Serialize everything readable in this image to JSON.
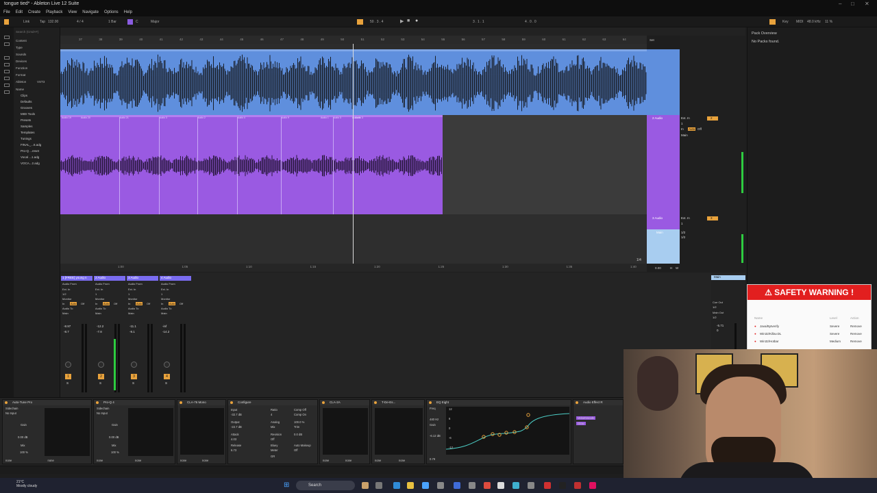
{
  "window": {
    "title": "tongue tied* - Ableton Live 12 Suite",
    "controls": [
      "–",
      "□",
      "✕"
    ]
  },
  "menu": [
    "File",
    "Edit",
    "Create",
    "Playback",
    "View",
    "Navigate",
    "Options",
    "Help"
  ],
  "control_bar": {
    "link": "Link",
    "tap": "Tap",
    "tempo": "132.00",
    "signature": "4 / 4",
    "quantize": "1 Bar",
    "key_root": "C",
    "scale": "Major",
    "position": "50 . 3 . 4",
    "loop_start": "3 . 1 . 1",
    "loop_length": "4 . 0 . 0",
    "key_label": "Key",
    "midi_label": "MIDI",
    "sample_rate": "48.0 kHz",
    "cpu": "11 %"
  },
  "browser": {
    "search_placeholder": "Search (Cmd+F)",
    "filters": [
      "Content",
      "Type",
      "Sounds",
      "Devices",
      "Function",
      "Format",
      "Ableton",
      "VST3"
    ],
    "name_header": "Name",
    "items": [
      "Clips",
      "Defaults",
      "Grooves",
      "MIDI Tools",
      "Presets",
      "Samples",
      "Templates",
      "Tunings",
      "FINAL_...6.adg",
      "Pro-Q ...reset",
      "Vocal ...1.adg",
      "VOCA...2.adg"
    ]
  },
  "ruler_marks": [
    "37",
    "38",
    "39",
    "40",
    "41",
    "42",
    "43",
    "44",
    "45",
    "46",
    "47",
    "48",
    "49",
    "50",
    "51",
    "52",
    "53",
    "54",
    "55",
    "56",
    "57",
    "58",
    "59",
    "60",
    "61",
    "62",
    "63",
    "64"
  ],
  "time_marks": [
    "1:00",
    "1:05",
    "1:10",
    "1:15",
    "1:20",
    "1:25",
    "1:30",
    "1:35",
    "1:40"
  ],
  "page_fraction": "1/4",
  "clip_labels": [
    "Audio 19",
    "Audio 20",
    "Audio 21",
    "Audio 3",
    "Audio 2",
    "Audio 4",
    "Audio 9",
    "Audio 1",
    "Audio 3",
    "Audio 6",
    "Audio 3"
  ],
  "tracks": [
    {
      "name": "2 Audio",
      "input": "Ext. In",
      "channel": "1",
      "monitor_in": "In",
      "monitor_auto": "Auto",
      "monitor_off": "Off",
      "out": "Main",
      "num": "2"
    },
    {
      "name": "3 Audio",
      "input": "Ext. In",
      "channel": "1",
      "out": "1/2",
      "num": "3"
    },
    {
      "name": "Main",
      "input": "1/2",
      "out": "1/2"
    }
  ],
  "session_labels": {
    "set": "Set",
    "zoom": "0.00",
    "h": "H",
    "w": "W"
  },
  "mixer": {
    "channels": [
      {
        "name": "1 [FREE] young n",
        "audio_from": "Audio From",
        "ext_in": "Ext. In",
        "ch": "1/2",
        "monitor": "Monitor",
        "in": "In",
        "auto": "Auto",
        "off": "Off",
        "audio_to": "Audio To",
        "main": "Main",
        "vol": "-8.97",
        "peak": "-8.7",
        "num": "1",
        "s": "S"
      },
      {
        "name": "2 Audio",
        "audio_from": "Audio From",
        "ext_in": "Ext. In",
        "ch": "1",
        "monitor": "Monitor",
        "in": "In",
        "auto": "Auto",
        "off": "Off",
        "audio_to": "Audio To",
        "main": "Main",
        "vol": "-12.2",
        "peak": "-7.8",
        "num": "2",
        "s": "S"
      },
      {
        "name": "3 Audio",
        "audio_from": "Audio From",
        "ext_in": "Ext. In",
        "ch": "1",
        "monitor": "Monitor",
        "in": "In",
        "auto": "Auto",
        "off": "Off",
        "audio_to": "Audio To",
        "main": "Main",
        "vol": "-11.1",
        "peak": "-9.1",
        "num": "3",
        "s": "S"
      },
      {
        "name": "4 Audio",
        "audio_from": "Audio From",
        "ext_in": "Ext. In",
        "ch": "1",
        "monitor": "Monitor",
        "in": "In",
        "auto": "Auto",
        "off": "Off",
        "audio_to": "Audio To",
        "main": "Main",
        "vol": "-inf",
        "peak": "-14.2",
        "num": "4",
        "s": "S"
      }
    ],
    "main": {
      "name": "Main",
      "cue_out": "Cue Out",
      "cue_val": "1/2",
      "main_out": "Main Out",
      "main_val": "1/2",
      "vol": "-5.71",
      "peak": "0"
    }
  },
  "devices": [
    {
      "name": "Auto-Tune Pro",
      "sidechain": "Sidechain",
      "no_input": "No Input",
      "gain": "Gain",
      "gain_val": "0.00 dB",
      "mix": "Mix",
      "mix_val": "100 %",
      "none1": "none",
      "none2": "none"
    },
    {
      "name": "Pro-Q 4",
      "sidechain": "Sidechain",
      "no_input": "No Input",
      "gain": "Gain",
      "gain_val": "0.00 dB",
      "mix": "Mix",
      "mix_val": "100 %",
      "none1": "none",
      "none2": "none"
    },
    {
      "name": "CLA-76 Mono",
      "none1": "none",
      "none2": "none"
    },
    {
      "name": "Configure",
      "input": "Input",
      "input_val": "-32.7 dB",
      "ratio": "Ratio",
      "ratio_val": "4",
      "comp_off": "Comp Off",
      "comp_on": "Comp On",
      "output": "Output",
      "analog": "Analog",
      "mix": "Mix",
      "output_val": "-22.7 dB",
      "attack": "Attack",
      "attack_val": "4.03",
      "revision": "Revision",
      "off": "Off",
      "mix_val": "100.0 %",
      "trim": "Trim",
      "trim_val": "0.0 dB",
      "release": "Release",
      "release_val": "6.73",
      "bluey": "Bluey",
      "meter": "Meter",
      "meter_val": "GR",
      "auto_makeup": "Auto Makeup",
      "off2": "Off"
    },
    {
      "name": "CLA-2A",
      "none1": "none",
      "none2": "none"
    },
    {
      "name": "T-De-Es...",
      "none1": "none",
      "none2": "none"
    },
    {
      "name": "EQ Eight",
      "freq": "Freq",
      "freq_val": "440 Hz",
      "gain": "Gain",
      "gain_val": "-6.12 dB",
      "q_val": "0.79",
      "mode": "Mode",
      "stereo": "Stereo",
      "edit": "Edit",
      "adapt_q": "Adapt. Q",
      "on": "On",
      "scale": "Scale",
      "scale_val": "100 %",
      "output": "Output",
      "output_val": "0.00 dB",
      "ticks": [
        "12",
        "6",
        "0",
        "-6",
        "-12"
      ]
    },
    {
      "name": "Audio Effect R",
      "items": [
        "VelvetVocals",
        "Glow"
      ]
    }
  ],
  "pack_panel": {
    "title": "Pack Overview",
    "message": "No Packs found."
  },
  "warning": {
    "title": "⚠ SAFETY WARNING !",
    "columns": [
      "Name",
      "Level",
      "Action"
    ],
    "rows": [
      {
        "name": "Java/Bytverify",
        "level": "Severe",
        "action": "Remove"
      },
      {
        "name": "Win32/Killav.DL",
        "level": "Severe",
        "action": "Remove"
      },
      {
        "name": "Win32/Hotbar",
        "level": "Medium",
        "action": "Remove"
      }
    ]
  },
  "taskbar": {
    "temp": "21°C",
    "weather": "Mostly cloudy",
    "search": "Search"
  },
  "colors": {
    "blue_clip": "#5f8fdd",
    "purple_clip": "#9a5ae2",
    "accent": "#e8a23c",
    "warning": "#e21f1f"
  }
}
